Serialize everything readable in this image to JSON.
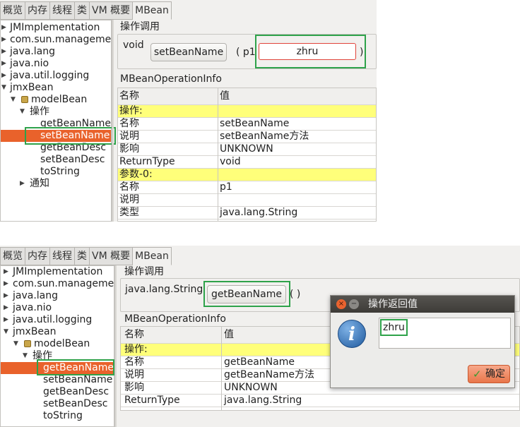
{
  "screens": [
    {
      "tabs": [
        "概览",
        "内存",
        "线程",
        "类",
        "VM 概要",
        "MBean"
      ],
      "tree": [
        "JMImplementation",
        "com.sun.manageme",
        "java.lang",
        "java.nio",
        "java.util.logging",
        "jmxBean",
        "modelBean",
        "操作",
        "getBeanName",
        "setBeanName",
        "getBeanDesc",
        "setBeanDesc",
        "toString",
        "通知"
      ],
      "invoke": {
        "title": "操作调用",
        "return_type": "void",
        "button": "setBeanName",
        "param_open": "( p1",
        "param_value": "zhru",
        "param_close": ")"
      },
      "info": {
        "title": "MBeanOperationInfo",
        "headers": [
          "名称",
          "值"
        ],
        "rows": [
          [
            "操作:",
            ""
          ],
          [
            "名称",
            "setBeanName"
          ],
          [
            "说明",
            "setBeanName方法"
          ],
          [
            "影响",
            "UNKNOWN"
          ],
          [
            "ReturnType",
            "void"
          ],
          [
            "参数-0:",
            ""
          ],
          [
            "名称",
            "p1"
          ],
          [
            "说明",
            ""
          ],
          [
            "类型",
            "java.lang.String"
          ]
        ]
      }
    },
    {
      "tabs": [
        "概览",
        "内存",
        "线程",
        "类",
        "VM 概要",
        "MBean"
      ],
      "tree": [
        "JMImplementation",
        "com.sun.manageme",
        "java.lang",
        "java.nio",
        "java.util.logging",
        "jmxBean",
        "modelBean",
        "操作",
        "getBeanName",
        "setBeanName",
        "getBeanDesc",
        "setBeanDesc",
        "toString"
      ],
      "invoke": {
        "title": "操作调用",
        "return_type": "java.lang.String",
        "button": "getBeanName",
        "parens": "( )"
      },
      "info": {
        "title": "MBeanOperationInfo",
        "headers": [
          "名称",
          "值"
        ],
        "rows": [
          [
            "操作:",
            ""
          ],
          [
            "名称",
            "getBeanName"
          ],
          [
            "说明",
            "getBeanName方法"
          ],
          [
            "影响",
            "UNKNOWN"
          ],
          [
            "ReturnType",
            "java.lang.String"
          ]
        ]
      },
      "dialog": {
        "title": "操作返回值",
        "result": "zhru",
        "ok_label": "确定",
        "close_glyph": "×",
        "min_glyph": "−",
        "info_glyph": "i",
        "check_glyph": "✓"
      }
    }
  ],
  "colors": {
    "selection": "#e9622b",
    "highlight_box": "#2ea24a",
    "yellow_row": "#ffff7a",
    "input_border": "#e0433a"
  },
  "icons": [
    "bean-icon",
    "info-icon",
    "close-icon",
    "minimize-icon",
    "checkmark-icon",
    "tree-expand-arrow-icon"
  ]
}
